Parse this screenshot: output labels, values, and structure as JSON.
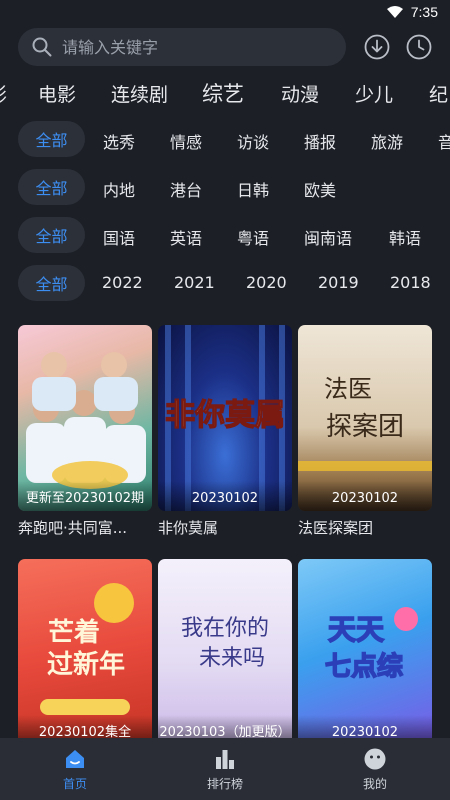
{
  "status": {
    "time": "7:35"
  },
  "search": {
    "placeholder": "请输入关键字"
  },
  "categories": [
    {
      "label": "影"
    },
    {
      "label": "电影"
    },
    {
      "label": "连续剧"
    },
    {
      "label": "综艺"
    },
    {
      "label": "动漫"
    },
    {
      "label": "少儿"
    },
    {
      "label": "纪"
    }
  ],
  "filters": {
    "genre": {
      "all": "全部",
      "items": [
        "选秀",
        "情感",
        "访谈",
        "播报",
        "旅游",
        "音"
      ]
    },
    "region": {
      "all": "全部",
      "items": [
        "内地",
        "港台",
        "日韩",
        "欧美"
      ]
    },
    "language": {
      "all": "全部",
      "items": [
        "国语",
        "英语",
        "粤语",
        "闽南语",
        "韩语"
      ]
    },
    "year": {
      "all": "全部",
      "items": [
        "2022",
        "2021",
        "2020",
        "2019",
        "2018"
      ]
    }
  },
  "cards": [
    {
      "caption": "更新至20230102期",
      "title": "奔跑吧·共同富..."
    },
    {
      "caption": "20230102",
      "title": "非你莫属"
    },
    {
      "caption": "20230102",
      "title": "法医探案团"
    },
    {
      "caption": "20230102集全",
      "title": ""
    },
    {
      "caption": "20230103（加更版）",
      "title": ""
    },
    {
      "caption": "20230102",
      "title": ""
    }
  ],
  "poster_text": {
    "p2": "非你莫属",
    "p3": "法医探案团",
    "p4a": "芒着",
    "p4b": "过新年",
    "p5a": "我在你的",
    "p5b": "未来吗",
    "p6a": "天天",
    "p6b": "七点综"
  },
  "nav": [
    {
      "label": "首页",
      "icon": "home-icon"
    },
    {
      "label": "排行榜",
      "icon": "ranking-icon"
    },
    {
      "label": "我的",
      "icon": "profile-icon"
    }
  ],
  "colors": {
    "accent": "#3d8ef2",
    "background": "#1c1f26",
    "chip": "#2c3039"
  }
}
